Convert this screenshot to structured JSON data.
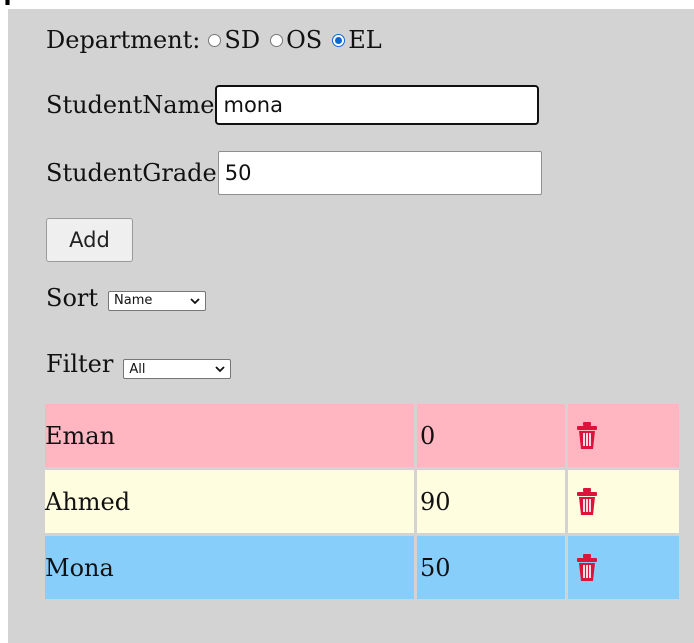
{
  "page": {
    "header_fragment": "T"
  },
  "form": {
    "department_label": "Department:",
    "departments": [
      {
        "label": "SD",
        "checked": false
      },
      {
        "label": "OS",
        "checked": false
      },
      {
        "label": "EL",
        "checked": true
      }
    ],
    "student_name_label": "StudentName",
    "student_name_value": "mona",
    "student_grade_label": "StudentGrade",
    "student_grade_value": "50",
    "add_label": "Add"
  },
  "sort": {
    "label": "Sort",
    "selected": "Name"
  },
  "filter": {
    "label": "Filter",
    "selected": "All"
  },
  "students": [
    {
      "name": "Eman",
      "grade": "0",
      "color": "#ffb6c1"
    },
    {
      "name": "Ahmed",
      "grade": "90",
      "color": "#fffde0"
    },
    {
      "name": "Mona",
      "grade": "50",
      "color": "#87cefa"
    }
  ],
  "colors": {
    "panel": "#d3d3d3",
    "delete_icon": "#dc143c",
    "radio_checked": "#0a66d6"
  },
  "icons": {
    "delete": "trash-icon"
  }
}
